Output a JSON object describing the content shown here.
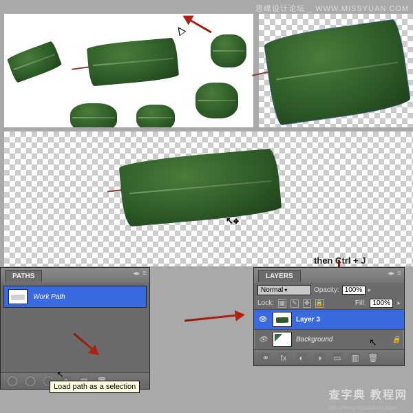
{
  "watermark": {
    "top": "思缘设计论坛 _ WWW.MISSYUAN.COM",
    "bottom_big": "查字典 教程网",
    "bottom_small": "jiaocheng.chazidian.com"
  },
  "instruction": "then Ctrl + J",
  "paths_panel": {
    "tab": "PATHS",
    "work_path": "Work Path",
    "tooltip": "Load path as a selection"
  },
  "layers_panel": {
    "tab": "LAYERS",
    "blend_mode": "Normal",
    "opacity_label": "Opacity:",
    "opacity_value": "100%",
    "lock_label": "Lock:",
    "fill_label": "Fill:",
    "fill_value": "100%",
    "layer3": "Layer 3",
    "background": "Background"
  }
}
